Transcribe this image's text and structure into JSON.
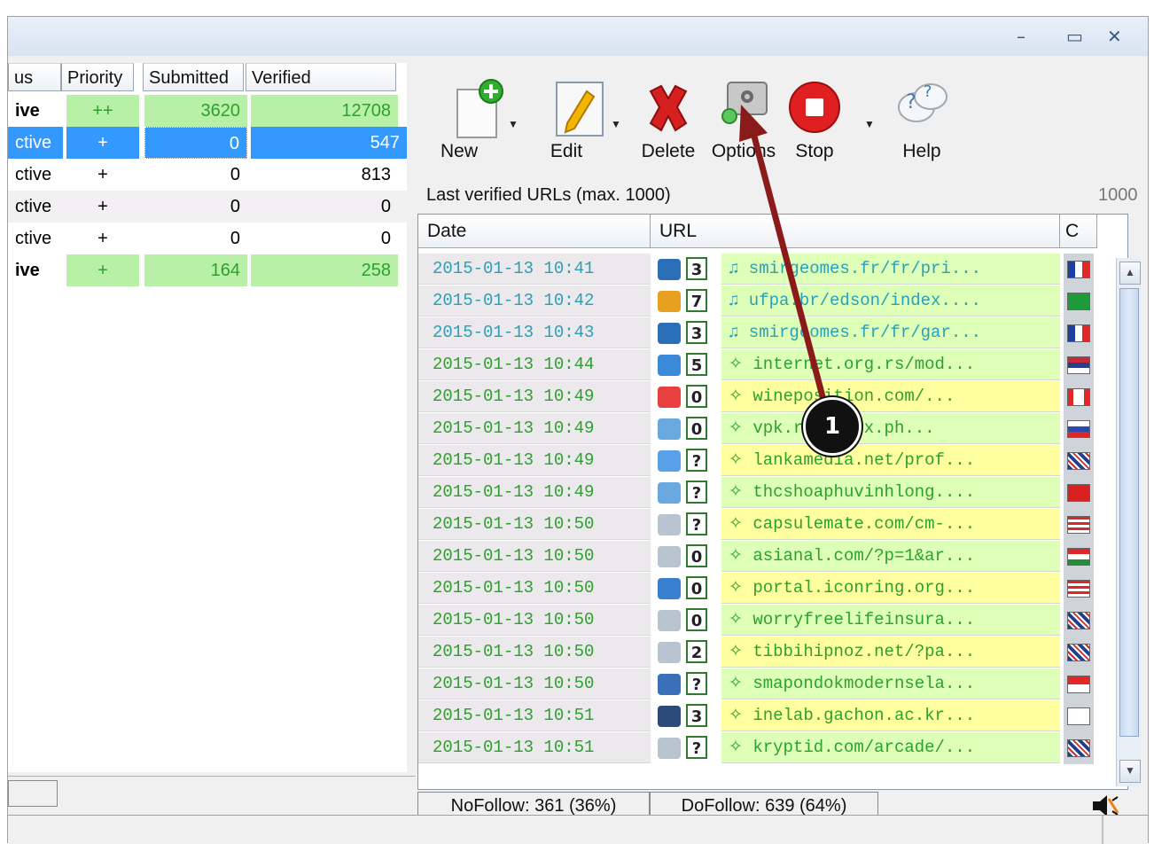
{
  "window": {
    "minimize_label": "–",
    "maximize_label": "▭",
    "close_label": "✕"
  },
  "left_table": {
    "headers": {
      "status": "us",
      "priority": "Priority",
      "submitted": "Submitted",
      "verified": "Verified"
    },
    "rows": [
      {
        "status": "ive",
        "priority": "++",
        "submitted": "3620",
        "verified": "12708"
      },
      {
        "status": "ctive",
        "priority": "+",
        "submitted": "0",
        "verified": "547"
      },
      {
        "status": "ctive",
        "priority": "+",
        "submitted": "0",
        "verified": "813"
      },
      {
        "status": "ctive",
        "priority": "+",
        "submitted": "0",
        "verified": "0"
      },
      {
        "status": "ctive",
        "priority": "+",
        "submitted": "0",
        "verified": "0"
      },
      {
        "status": "ive",
        "priority": "+",
        "submitted": "164",
        "verified": "258"
      }
    ]
  },
  "toolbar": {
    "new_label": "New",
    "edit_label": "Edit",
    "delete_label": "Delete",
    "options_label": "Options",
    "stop_label": "Stop",
    "help_label": "Help",
    "help_glyph": "?"
  },
  "panel": {
    "title": "Last verified URLs (max. 1000)",
    "count": "1000"
  },
  "url_table": {
    "headers": {
      "date": "Date",
      "url": "URL",
      "country": "C"
    },
    "rows": [
      {
        "date": "2015-01-13 10:41",
        "pr": "3",
        "url": "♫ smirgeomes.fr/fr/pri...",
        "icon": "drupal-icon",
        "flag": "france-flag"
      },
      {
        "date": "2015-01-13 10:42",
        "pr": "7",
        "url": "♫ ufpa.br/edson/index....",
        "icon": "joomla-icon",
        "flag": "brazil-flag"
      },
      {
        "date": "2015-01-13 10:43",
        "pr": "3",
        "url": "♫ smirgeomes.fr/fr/gar...",
        "icon": "drupal-icon",
        "flag": "france-flag"
      },
      {
        "date": "2015-01-13 10:44",
        "pr": "5",
        "url": "✧ internet.org.rs/mod...",
        "icon": "sync-icon",
        "flag": "serbia-flag"
      },
      {
        "date": "2015-01-13 10:49",
        "pr": "0",
        "url": "✧ wineposition.com/...",
        "icon": "blocks-icon",
        "flag": "canada-flag"
      },
      {
        "date": "2015-01-13 10:49",
        "pr": "0",
        "url": "✧ vpk.ru/index.ph...",
        "icon": "puzzle-icon",
        "flag": "russia-flag"
      },
      {
        "date": "2015-01-13 10:49",
        "pr": "?",
        "url": "✧ lankamedia.net/prof...",
        "icon": "music-icon",
        "flag": "uk-flag"
      },
      {
        "date": "2015-01-13 10:49",
        "pr": "?",
        "url": "✧ thcshoaphuvinhlong....",
        "icon": "puzzle-icon",
        "flag": "vietnam-flag"
      },
      {
        "date": "2015-01-13 10:50",
        "pr": "?",
        "url": "✧ capsulemate.com/cm-...",
        "icon": "comment-icon",
        "flag": "usa-flag"
      },
      {
        "date": "2015-01-13 10:50",
        "pr": "0",
        "url": "✧ asianal.com/?p=1&ar...",
        "icon": "comment-icon",
        "flag": "hungary-flag"
      },
      {
        "date": "2015-01-13 10:50",
        "pr": "0",
        "url": "✧ portal.iconring.org...",
        "icon": "bird-icon",
        "flag": "usa-flag"
      },
      {
        "date": "2015-01-13 10:50",
        "pr": "0",
        "url": "✧ worryfreelifeinsura...",
        "icon": "comment-icon",
        "flag": "uk-flag"
      },
      {
        "date": "2015-01-13 10:50",
        "pr": "2",
        "url": "✧ tibbihipnoz.net/?pa...",
        "icon": "comment-icon",
        "flag": "uk-flag"
      },
      {
        "date": "2015-01-13 10:50",
        "pr": "?",
        "url": "✧ smapondokmodernsela...",
        "icon": "camera-icon",
        "flag": "indonesia-flag"
      },
      {
        "date": "2015-01-13 10:51",
        "pr": "3",
        "url": "✧ inelab.gachon.ac.kr...",
        "icon": "x-icon",
        "flag": "korea-flag"
      },
      {
        "date": "2015-01-13 10:51",
        "pr": "?",
        "url": "✧ kryptid.com/arcade/...",
        "icon": "comment-icon",
        "flag": "uk-flag"
      }
    ]
  },
  "status": {
    "nofollow": "NoFollow: 361 (36%)",
    "dofollow": "DoFollow: 639 (64%)"
  },
  "annotation": {
    "label": "1"
  },
  "colors": {
    "green_text": "#2ea02e",
    "teal_text": "#2aa0b8",
    "selection_blue": "#3399ff",
    "row_green": "#b9f0a8",
    "row_yellow": "#ffffa0",
    "row_light_green": "#ddffb8",
    "arrow_red": "#8b1a1a"
  }
}
